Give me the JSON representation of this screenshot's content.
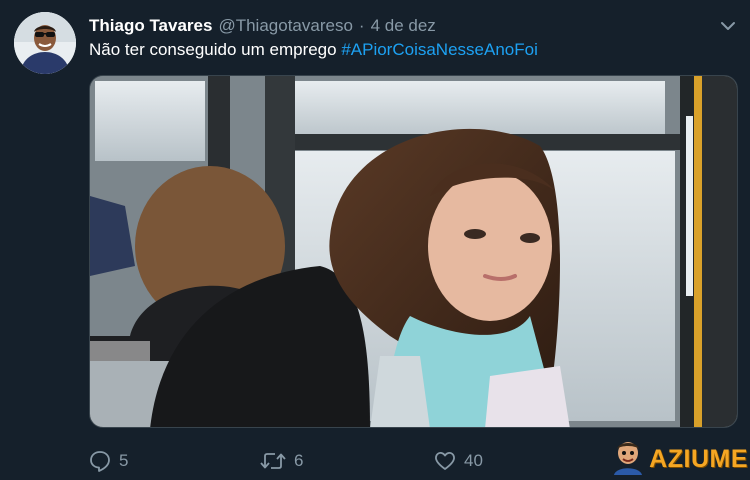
{
  "tweet": {
    "author_name": "Thiago Tavares",
    "handle": "@Thiagotavareso",
    "separator": "·",
    "date": "4 de dez",
    "text": "Não ter conseguido um emprego ",
    "hashtag": "#APiorCoisaNesseAnoFoi"
  },
  "actions": {
    "replies": "5",
    "retweets": "6",
    "likes": "40"
  },
  "icons": {
    "menu": "chevron-down-icon",
    "reply": "reply-icon",
    "retweet": "retweet-icon",
    "like": "heart-icon"
  },
  "watermark": {
    "text": "AZIUME"
  },
  "colors": {
    "background": "#15202b",
    "muted": "#8899a6",
    "link": "#1da1f2",
    "watermark": "#f5a623"
  }
}
